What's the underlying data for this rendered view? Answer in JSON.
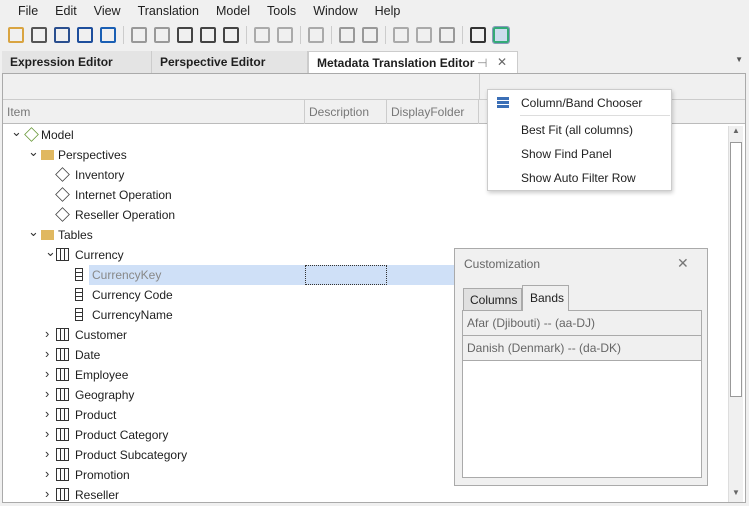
{
  "menu": [
    "File",
    "Edit",
    "View",
    "Translation",
    "Model",
    "Tools",
    "Window",
    "Help"
  ],
  "toolbar_icons": [
    "open-icon",
    "deploy-icon",
    "copy-icon",
    "save-icon",
    "refresh-icon",
    "doc-icon",
    "form-icon",
    "script-icon",
    "hierarchy-icon",
    "page-icon",
    "indent-icon",
    "outdent-icon",
    "align-icon",
    "center-icon",
    "move-icon",
    "box-icon",
    "comment-icon",
    "layout-icon",
    "translate-icon",
    "edit-pane-icon"
  ],
  "tabs": [
    "Expression Editor",
    "Perspective Editor",
    "Metadata Translation Editor"
  ],
  "columns": [
    "Item",
    "Description",
    "DisplayFolder"
  ],
  "tree": [
    {
      "label": "Model",
      "level": 0,
      "arrow": "v",
      "icon": "model"
    },
    {
      "label": "Perspectives",
      "level": 1,
      "arrow": "v",
      "icon": "folder"
    },
    {
      "label": "Inventory",
      "level": 2,
      "arrow": "",
      "icon": "cube"
    },
    {
      "label": "Internet Operation",
      "level": 2,
      "arrow": "",
      "icon": "cube"
    },
    {
      "label": "Reseller Operation",
      "level": 2,
      "arrow": "",
      "icon": "cube"
    },
    {
      "label": "Tables",
      "level": 1,
      "arrow": "v",
      "icon": "folder"
    },
    {
      "label": "Currency",
      "level": 2,
      "arrow": "v",
      "icon": "table"
    },
    {
      "label": "CurrencyKey",
      "level": 3,
      "arrow": "",
      "icon": "column",
      "selected": true
    },
    {
      "label": "Currency Code",
      "level": 3,
      "arrow": "",
      "icon": "column"
    },
    {
      "label": "CurrencyName",
      "level": 3,
      "arrow": "",
      "icon": "column"
    },
    {
      "label": "Customer",
      "level": 2,
      "arrow": ">",
      "icon": "table"
    },
    {
      "label": "Date",
      "level": 2,
      "arrow": ">",
      "icon": "date"
    },
    {
      "label": "Employee",
      "level": 2,
      "arrow": ">",
      "icon": "table"
    },
    {
      "label": "Geography",
      "level": 2,
      "arrow": ">",
      "icon": "table"
    },
    {
      "label": "Product",
      "level": 2,
      "arrow": ">",
      "icon": "table"
    },
    {
      "label": "Product Category",
      "level": 2,
      "arrow": ">",
      "icon": "table"
    },
    {
      "label": "Product Subcategory",
      "level": 2,
      "arrow": ">",
      "icon": "table"
    },
    {
      "label": "Promotion",
      "level": 2,
      "arrow": ">",
      "icon": "table"
    },
    {
      "label": "Reseller",
      "level": 2,
      "arrow": ">",
      "icon": "table"
    }
  ],
  "context_menu": {
    "items": [
      "Column/Band Chooser",
      "Best Fit (all columns)",
      "Show Find Panel",
      "Show Auto Filter Row"
    ]
  },
  "customization": {
    "title": "Customization",
    "tabs": [
      "Columns",
      "Bands"
    ],
    "active_tab": "Bands",
    "bands": [
      "Afar (Djibouti) -- (aa-DJ)",
      "Danish (Denmark) -- (da-DK)"
    ]
  }
}
